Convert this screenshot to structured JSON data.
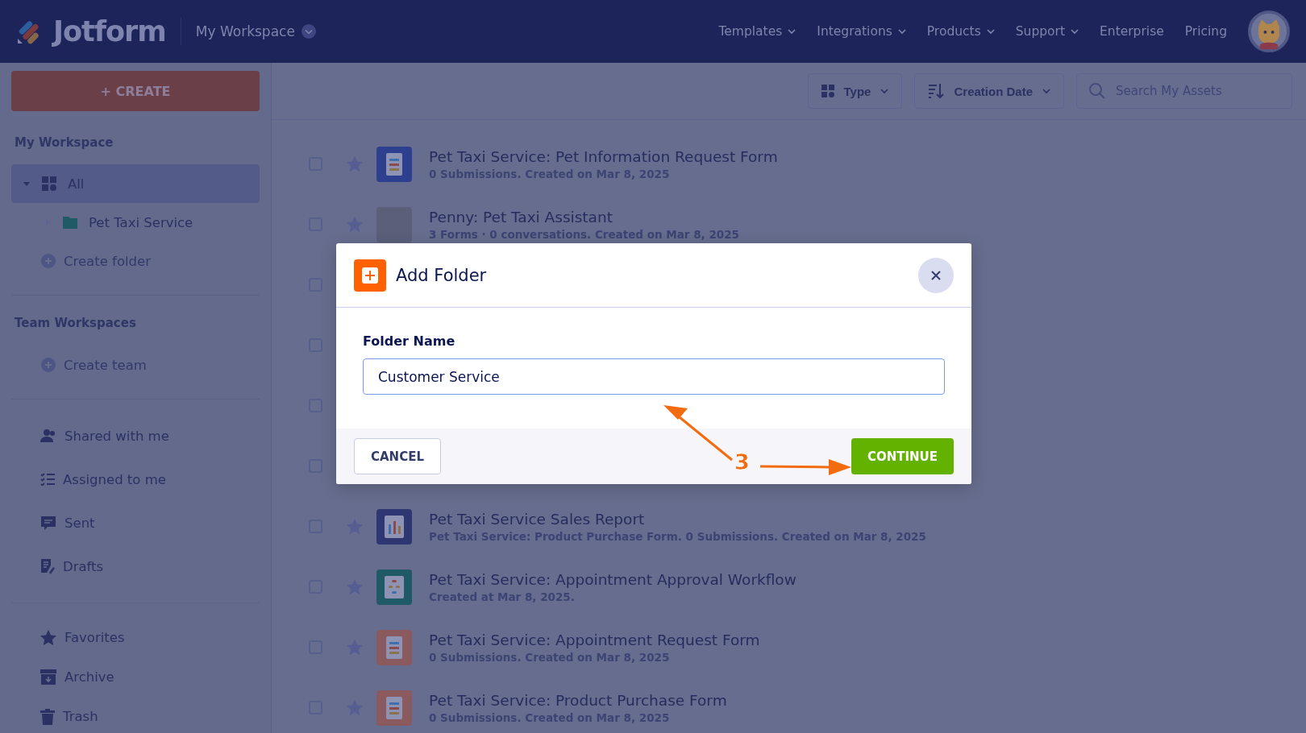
{
  "header": {
    "logo": "Jotform",
    "workspace": "My Workspace",
    "nav": [
      {
        "label": "Templates",
        "dropdown": true
      },
      {
        "label": "Integrations",
        "dropdown": true
      },
      {
        "label": "Products",
        "dropdown": true
      },
      {
        "label": "Support",
        "dropdown": true
      },
      {
        "label": "Enterprise",
        "dropdown": false
      },
      {
        "label": "Pricing",
        "dropdown": false
      }
    ]
  },
  "create_button": "+ CREATE",
  "toolbar": {
    "type_filter": "Type",
    "sort": "Creation Date",
    "search": {
      "placeholder": "Search My Assets"
    }
  },
  "sidebar": {
    "my_workspace": {
      "heading": "My Workspace",
      "tree": [
        {
          "label": "All",
          "selected": true,
          "expanded": true,
          "children": [
            {
              "label": "Pet Taxi Service",
              "selected": false,
              "expanded": false
            }
          ]
        }
      ],
      "create_folder": "Create folder"
    },
    "team_workspaces": {
      "heading": "Team Workspaces",
      "create_team": "Create team"
    },
    "groups": [
      [
        {
          "kind": "shared",
          "label": "Shared with me",
          "selected": false
        },
        {
          "kind": "assigned",
          "label": "Assigned to me",
          "selected": false
        },
        {
          "kind": "sent",
          "label": "Sent",
          "selected": false
        },
        {
          "kind": "drafts",
          "label": "Drafts",
          "selected": false
        }
      ],
      [
        {
          "kind": "favorites",
          "label": "Favorites",
          "selected": false
        },
        {
          "kind": "archive",
          "label": "Archive",
          "selected": false
        },
        {
          "kind": "trash",
          "label": "Trash",
          "selected": false
        }
      ]
    ]
  },
  "assets": [
    {
      "kind": "form",
      "color": "#2f3f8f",
      "title": "Pet Taxi Service: Pet Information Request Form",
      "subtitle": "0 Submissions. Created on Mar 8, 2025",
      "checked": false
    },
    {
      "kind": "agent",
      "title": "Penny: Pet Taxi Assistant",
      "subtitle": "3 Forms · 0 conversations. Created on Mar 8, 2025",
      "checked": false
    },
    {
      "kind": "covered",
      "checked": false
    },
    {
      "kind": "covered",
      "checked": false
    },
    {
      "kind": "covered",
      "checked": false
    },
    {
      "kind": "covered",
      "checked": false
    },
    {
      "kind": "report",
      "color": "#2f3773",
      "title": "Pet Taxi Service Sales Report",
      "subtitle": "Pet Taxi Service: Product Purchase Form. 0 Submissions. Created on Mar 8, 2025",
      "checked": false
    },
    {
      "kind": "workflow",
      "color": "#1f5a66",
      "title": "Pet Taxi Service: Appointment Approval Workflow",
      "subtitle": "Created at Mar 8, 2025.",
      "checked": false
    },
    {
      "kind": "form",
      "color": "#8a5a5e",
      "title": "Pet Taxi Service: Appointment Request Form",
      "subtitle": "0 Submissions. Created on Mar 8, 2025",
      "checked": false
    },
    {
      "kind": "form",
      "color": "#8a5a5e",
      "title": "Pet Taxi Service: Product Purchase Form",
      "subtitle": "0 Submissions. Created on Mar 8, 2025",
      "checked": false
    }
  ],
  "dialog": {
    "title": "Add Folder",
    "field_label": "Folder Name",
    "value": "Customer Service",
    "buttons": [
      {
        "kind": "secondary",
        "label": "CANCEL"
      },
      {
        "kind": "primary",
        "label": "CONTINUE"
      }
    ]
  },
  "annotation": {
    "step": "3"
  }
}
